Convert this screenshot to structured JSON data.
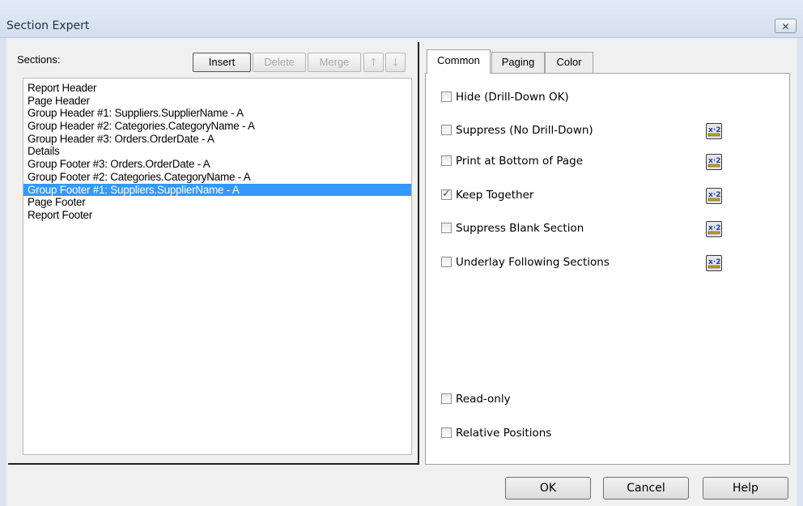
{
  "window": {
    "title": "Section Expert",
    "close_icon": "close-icon"
  },
  "left": {
    "sections_label": "Sections:",
    "buttons": {
      "insert": "Insert",
      "delete": "Delete",
      "merge": "Merge"
    },
    "sections": [
      "Report Header",
      "Page Header",
      "Group Header #1: Suppliers.SupplierName - A",
      "Group Header #2: Categories.CategoryName - A",
      "Group Header #3: Orders.OrderDate - A",
      "Details",
      "Group Footer #3: Orders.OrderDate - A",
      "Group Footer #2: Categories.CategoryName - A",
      "Group Footer #1: Suppliers.SupplierName - A",
      "Page Footer",
      "Report Footer"
    ],
    "selected_index": 8
  },
  "tabs": {
    "common": "Common",
    "paging": "Paging",
    "color": "Color",
    "active": "Common"
  },
  "options": {
    "hide": {
      "label": "Hide (Drill-Down OK)",
      "checked": false
    },
    "suppress": {
      "label": "Suppress (No Drill-Down)",
      "checked": false
    },
    "print_bottom": {
      "label": "Print at Bottom of Page",
      "checked": false
    },
    "keep_together": {
      "label": "Keep Together",
      "checked": true
    },
    "suppress_blank": {
      "label": "Suppress Blank Section",
      "checked": false
    },
    "underlay": {
      "label": "Underlay Following Sections",
      "checked": false
    },
    "read_only": {
      "label": "Read-only",
      "checked": false
    },
    "relative_positions": {
      "label": "Relative Positions",
      "checked": false
    }
  },
  "footer": {
    "ok": "OK",
    "cancel": "Cancel",
    "help": "Help"
  },
  "colors": {
    "selection": "#3399ff",
    "title_bar": "#dbe4ef",
    "formula_icon": "#1a3fa8"
  }
}
